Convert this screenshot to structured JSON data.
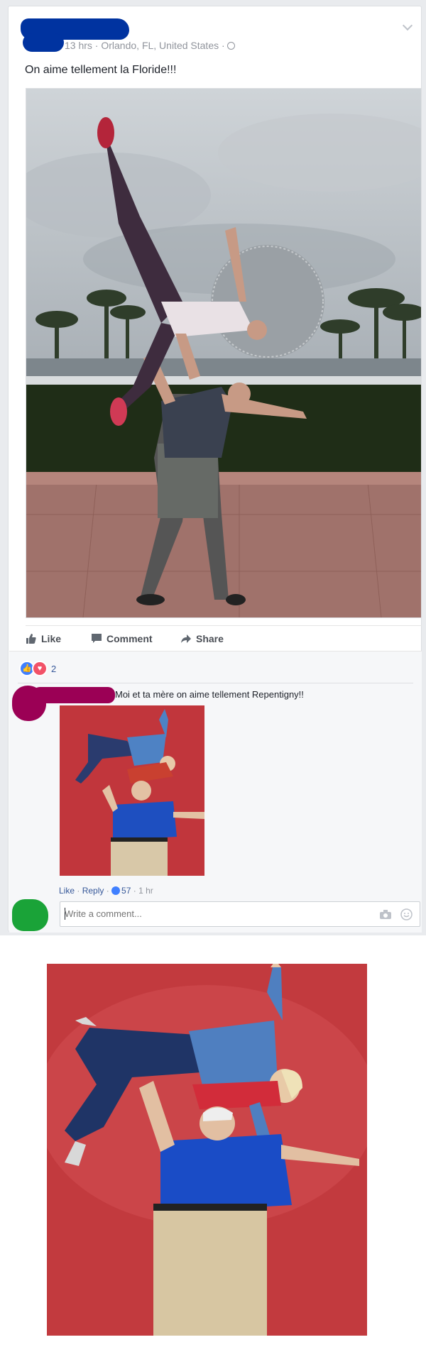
{
  "post": {
    "meta": "13 hrs · Orlando, FL, United States ·",
    "text": "On aime tellement la Floride!!!",
    "actions": {
      "like": "Like",
      "comment": "Comment",
      "share": "Share"
    },
    "reaction_count": "2"
  },
  "comment": {
    "text": "Moi et ta mère on aime tellement Repentigny!!",
    "like_label": "Like",
    "reply_label": "Reply",
    "likes_count": "57",
    "time": "1 hr",
    "separator": " · "
  },
  "composer": {
    "placeholder": "Write a comment..."
  },
  "colors": {
    "background": "#e9ebee",
    "link": "#365899",
    "like_blue": "#4080ff",
    "love_red": "#f25268"
  },
  "icons": [
    "chevron-down-icon",
    "globe-icon",
    "like-icon",
    "comment-icon",
    "share-icon",
    "camera-icon",
    "smiley-icon"
  ]
}
